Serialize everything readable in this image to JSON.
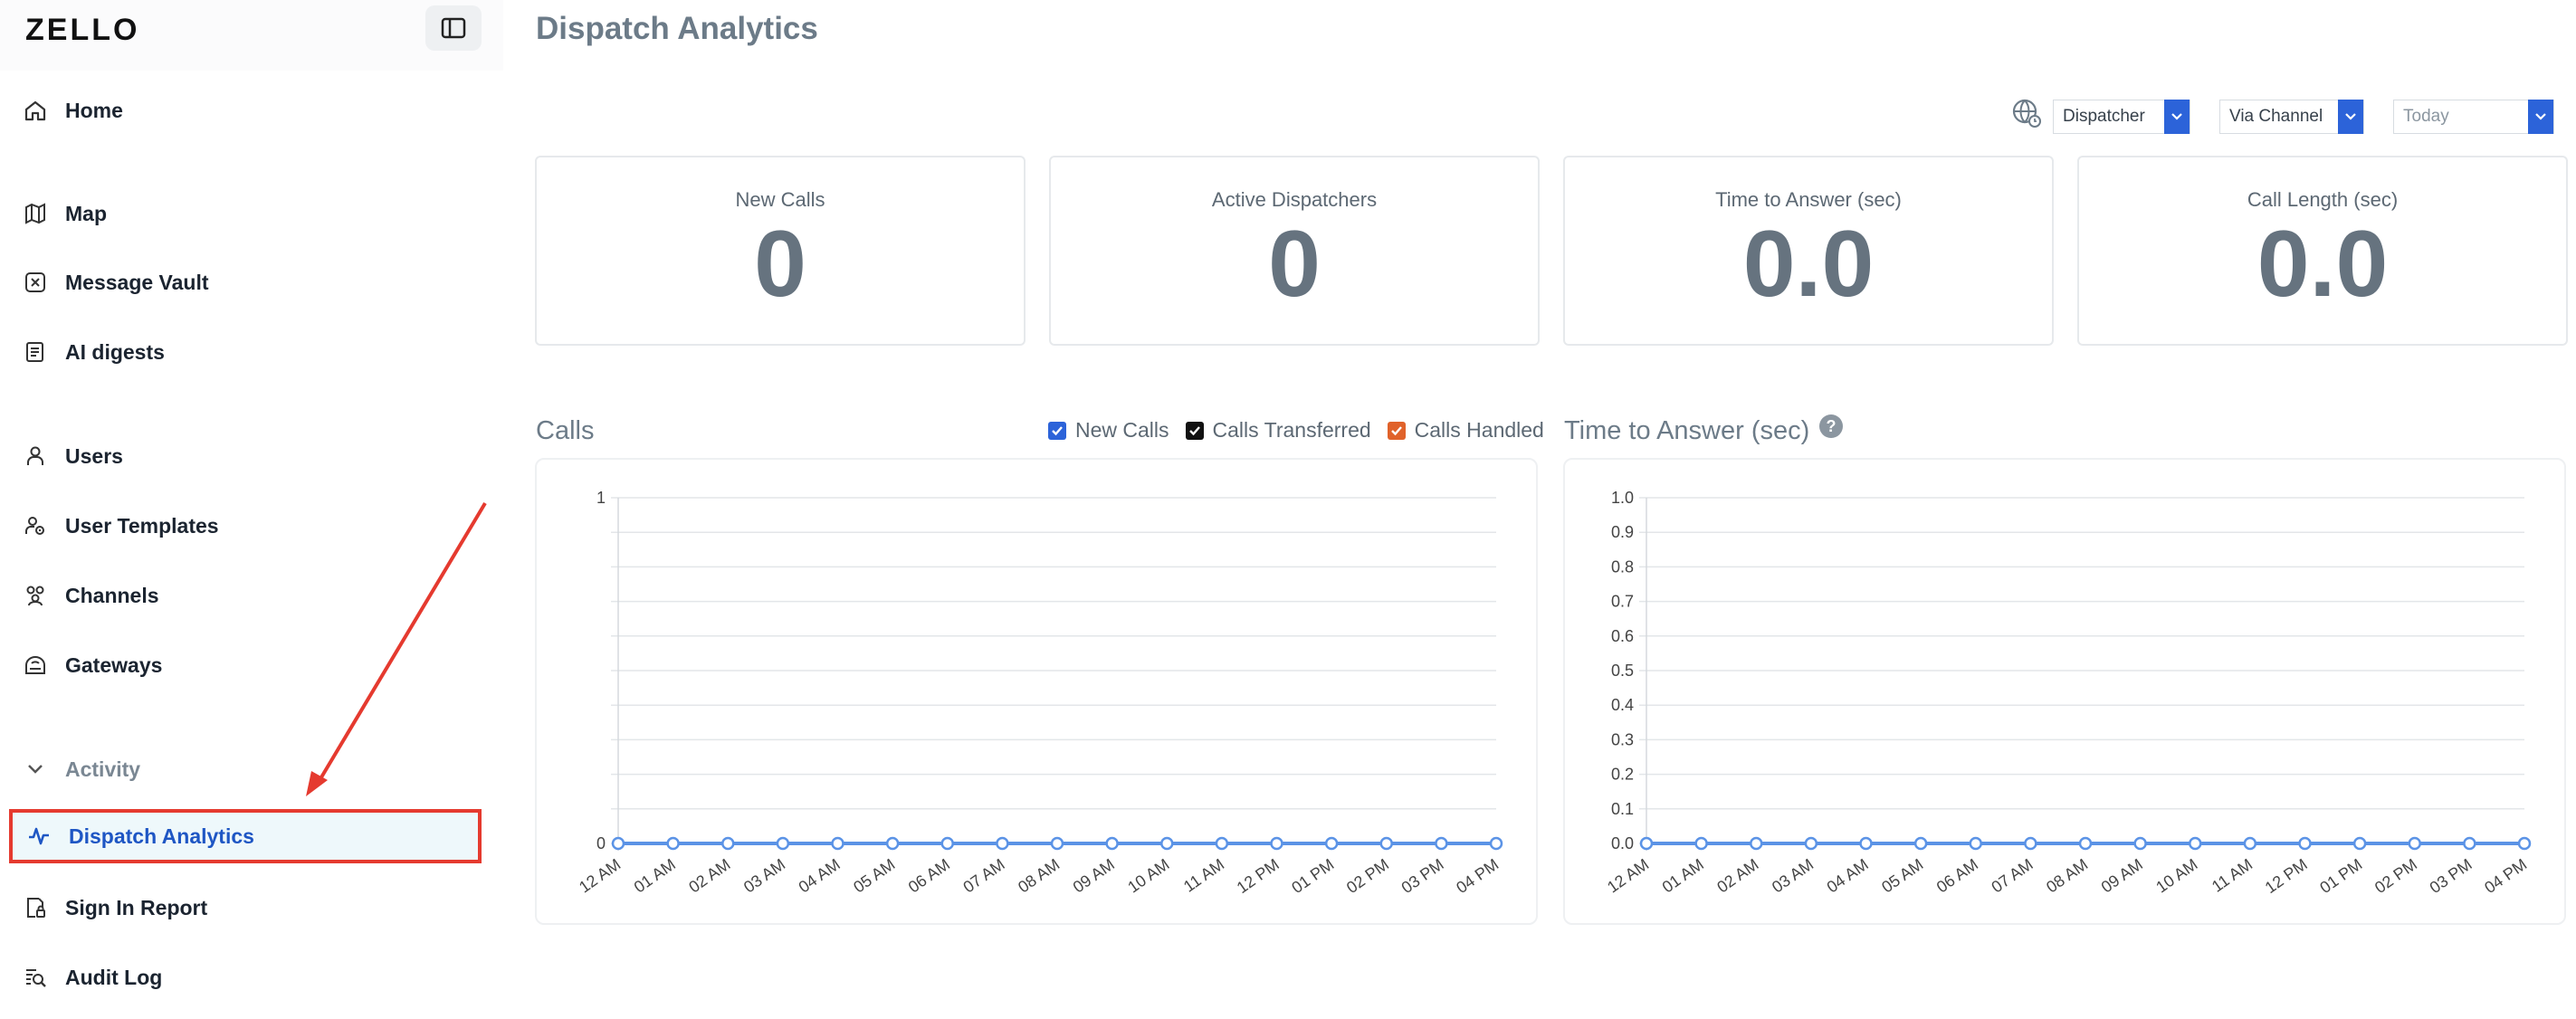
{
  "app": {
    "logo": "ZELLO"
  },
  "sidebar": {
    "items": [
      {
        "label": "Home",
        "icon": "home-icon"
      },
      {
        "label": "Map",
        "icon": "map-icon"
      },
      {
        "label": "Message Vault",
        "icon": "vault-icon"
      },
      {
        "label": "AI digests",
        "icon": "digest-icon"
      },
      {
        "label": "Users",
        "icon": "user-icon"
      },
      {
        "label": "User Templates",
        "icon": "user-template-icon"
      },
      {
        "label": "Channels",
        "icon": "channels-icon"
      },
      {
        "label": "Gateways",
        "icon": "gateway-icon"
      },
      {
        "label": "Activity",
        "icon": "chevron-down-icon"
      },
      {
        "label": "Dispatch Analytics",
        "icon": "pulse-icon"
      },
      {
        "label": "Sign In Report",
        "icon": "sign-in-report-icon"
      },
      {
        "label": "Audit Log",
        "icon": "audit-log-icon"
      }
    ]
  },
  "page": {
    "title": "Dispatch Analytics"
  },
  "filters": {
    "dispatcher": "Dispatcher",
    "channel": "Via Channel",
    "range": "Today"
  },
  "stats": [
    {
      "label": "New Calls",
      "value": "0"
    },
    {
      "label": "Active Dispatchers",
      "value": "0"
    },
    {
      "label": "Time to Answer (sec)",
      "value": "0.0"
    },
    {
      "label": "Call Length (sec)",
      "value": "0.0"
    }
  ],
  "calls_chart": {
    "title": "Calls",
    "legend": [
      "New Calls",
      "Calls Transferred",
      "Calls Handled"
    ],
    "colors": {
      "new": "#2c63d9",
      "transferred": "#111111",
      "handled": "#e0622a",
      "line": "#5b93e6"
    }
  },
  "answer_chart": {
    "title": "Time to Answer (sec)",
    "help": "?"
  },
  "chart_data": [
    {
      "type": "line",
      "title": "Calls",
      "x": [
        "12 AM",
        "01 AM",
        "02 AM",
        "03 AM",
        "04 AM",
        "05 AM",
        "06 AM",
        "07 AM",
        "08 AM",
        "09 AM",
        "10 AM",
        "11 AM",
        "12 PM",
        "01 PM",
        "02 PM",
        "03 PM",
        "04 PM"
      ],
      "series": [
        {
          "name": "New Calls",
          "values": [
            0,
            0,
            0,
            0,
            0,
            0,
            0,
            0,
            0,
            0,
            0,
            0,
            0,
            0,
            0,
            0,
            0
          ]
        }
      ],
      "ylim": [
        0,
        1
      ],
      "yticks": [
        "0",
        "1"
      ],
      "grid": true
    },
    {
      "type": "line",
      "title": "Time to Answer (sec)",
      "x": [
        "12 AM",
        "01 AM",
        "02 AM",
        "03 AM",
        "04 AM",
        "05 AM",
        "06 AM",
        "07 AM",
        "08 AM",
        "09 AM",
        "10 AM",
        "11 AM",
        "12 PM",
        "01 PM",
        "02 PM",
        "03 PM",
        "04 PM"
      ],
      "series": [
        {
          "values": [
            0,
            0,
            0,
            0,
            0,
            0,
            0,
            0,
            0,
            0,
            0,
            0,
            0,
            0,
            0,
            0,
            0
          ]
        }
      ],
      "ylim": [
        0,
        1
      ],
      "yticks": [
        "0.0",
        "0.1",
        "0.2",
        "0.3",
        "0.4",
        "0.5",
        "0.6",
        "0.7",
        "0.8",
        "0.9",
        "1.0"
      ],
      "grid": true
    }
  ]
}
